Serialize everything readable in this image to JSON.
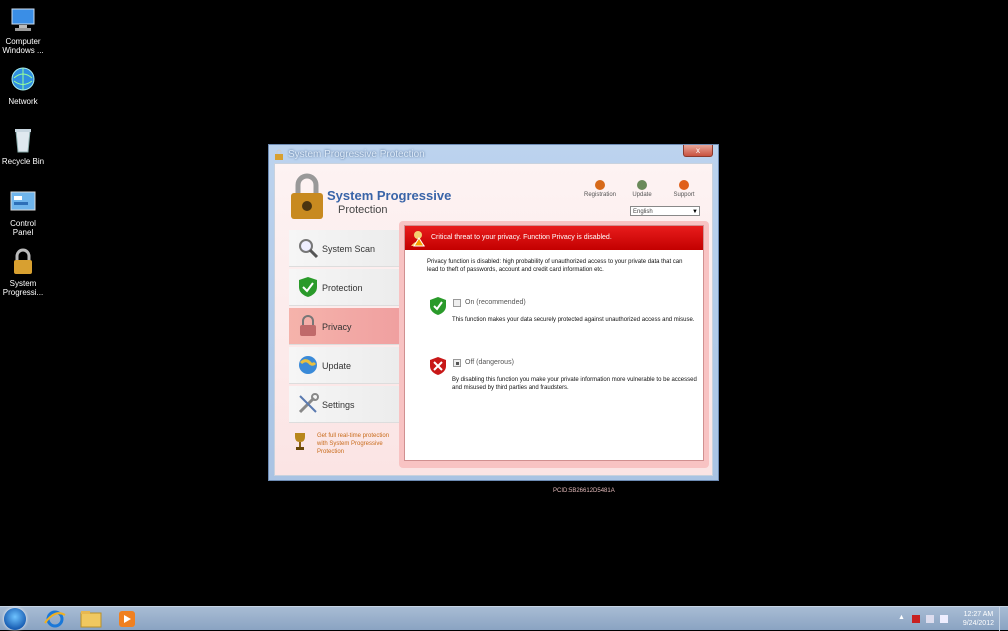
{
  "desktop": {
    "icons": [
      {
        "label": "Computer Windows ..."
      },
      {
        "label": "Network"
      },
      {
        "label": "Recycle Bin"
      },
      {
        "label": "Control Panel"
      },
      {
        "label": "System Progressi..."
      }
    ]
  },
  "window": {
    "title": "System Progressive Protection",
    "close": "x",
    "logo_line1": "System Progressive",
    "logo_line2": "Protection",
    "top_links": [
      "Registration",
      "Update",
      "Support"
    ],
    "language": "English",
    "nav": [
      "System Scan",
      "Protection",
      "Privacy",
      "Update",
      "Settings"
    ],
    "active_nav": "Privacy",
    "promo": "Get full real-time protection with System Progressive Protection",
    "alert": "Critical threat to your privacy. Function Privacy is disabled.",
    "description": "Privacy function is disabled: high probability of unauthorized access to your private data that can lead to theft of passwords, account and credit card information etc.",
    "option_on_label": "On (recommended)",
    "option_on_desc": "This function makes your data securely protected against unauthorized access and misuse.",
    "option_off_label": "Off (dangerous)",
    "option_off_desc": "By disabling this function you make your private information more vulnerable to be accessed and misused by third parties and fraudsters.",
    "code": "PCID:5B26612D5481A"
  },
  "taskbar": {
    "time": "12:27 AM",
    "date": "9/24/2012"
  },
  "colors": {
    "alert_red": "#d40000",
    "brand_blue": "#3964a8",
    "active_nav": "#f0a0a0"
  }
}
